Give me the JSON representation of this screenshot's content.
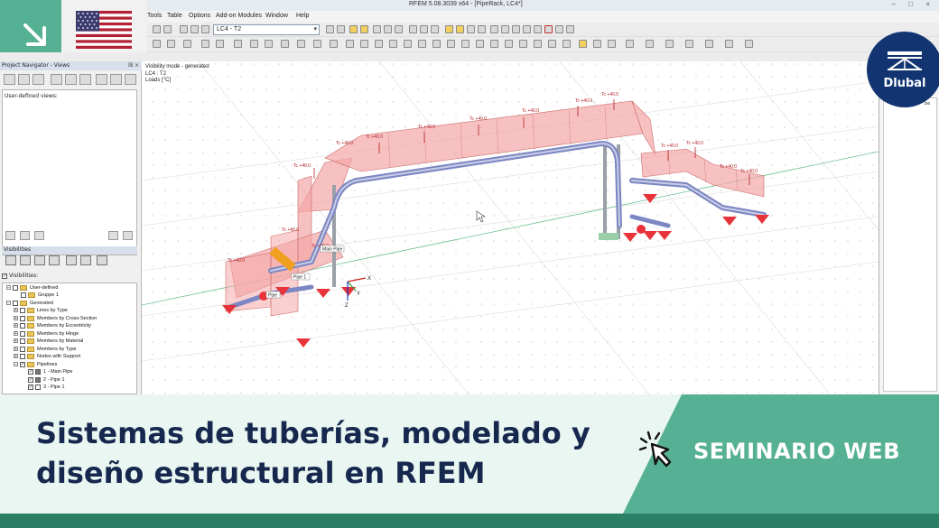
{
  "window": {
    "title": "RFEM 5.08.3039 x64 - [PipeRack, LC4*]",
    "controls": "– □ ×"
  },
  "menu": [
    "Tools",
    "Table",
    "Options",
    "Add-on Modules",
    "Window",
    "Help"
  ],
  "toolbar": {
    "load_case": "LC4 - T2"
  },
  "navigator": {
    "title": "Project Navigator - Views",
    "header_controls": "₪ ×",
    "user_defined_label": "User-defined views:",
    "visibilities_title": "Visibilities",
    "visibilities_checkbox": "Visibilities:",
    "tree": [
      "User-defined",
      "Gruppe 1",
      "Generated",
      "Lines by Type",
      "Members by Cross-Section",
      "Members by Eccentricity",
      "Members by Hinge",
      "Members by Material",
      "Members by Type",
      "Nodes with Support",
      "Pipelines",
      "1 - Main Pipe",
      "2 - Pipe 1",
      "3 - Pipe 1"
    ]
  },
  "viewport": {
    "info_line1": "Visibility mode - generated",
    "info_line2": "LC4 : T2",
    "info_line3": "Loads [°C]",
    "load_label": "Tc +40.0",
    "pipe_labels": {
      "main": "Main Pipe",
      "pipe1": "Pipe 1",
      "pipe": "Pipe"
    },
    "axes": {
      "x": "X",
      "y": "Y",
      "z": "Z"
    }
  },
  "right_panel": {
    "fragment": "be"
  },
  "logo": {
    "name": "Dlubal"
  },
  "banner": {
    "title_line1": "Sistemas de tuberías, modelado y",
    "title_line2": "diseño estructural en RFEM",
    "badge": "SEMINARIO WEB"
  },
  "colors": {
    "green": "#56b093",
    "dark_green": "#2a7f64",
    "navy": "#17284f",
    "logo_blue": "#123572",
    "load_fill": "#f2a3a3",
    "support_red": "#e8333a"
  }
}
